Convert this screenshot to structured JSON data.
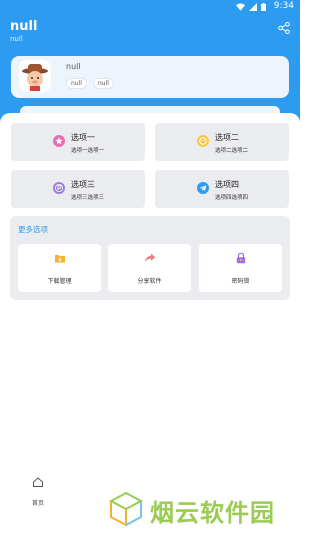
{
  "status_bar": {
    "time": "9:34"
  },
  "header": {
    "title": "null",
    "subtitle": "null"
  },
  "profile": {
    "name": "null",
    "tags": [
      "null",
      "null"
    ]
  },
  "options": [
    {
      "title": "选项一",
      "subtitle": "选项一选项一",
      "icon": "star-icon",
      "color": "#e76fb6"
    },
    {
      "title": "选项二",
      "subtitle": "选项二选项二",
      "icon": "smile-icon",
      "color": "#f6c94a"
    },
    {
      "title": "选项三",
      "subtitle": "选项三选项三",
      "icon": "p-badge-icon",
      "color": "#9a7cdb"
    },
    {
      "title": "选项四",
      "subtitle": "选项四选项四",
      "icon": "telegram-icon",
      "color": "#2d9bf0"
    }
  ],
  "more": {
    "title": "更多选项",
    "tools": [
      {
        "label": "下载管理",
        "icon": "download-folder-icon",
        "color": "#f2b335"
      },
      {
        "label": "分享软件",
        "icon": "share-arrow-icon",
        "color": "#f07a7a"
      },
      {
        "label": "密码锁",
        "icon": "lock-icon",
        "color": "#a070e0"
      }
    ]
  },
  "nav": {
    "home_label": "首页"
  },
  "watermark": {
    "text": "烟云软件园"
  },
  "colors": {
    "primary": "#2d9bf0",
    "panel": "#ebecef"
  }
}
